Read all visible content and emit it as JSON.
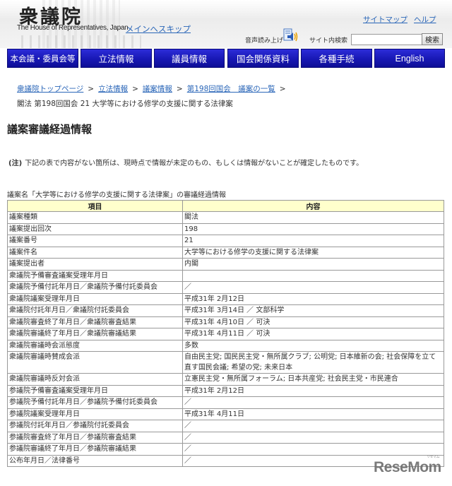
{
  "header": {
    "logo_kanji": "衆議院",
    "logo_english": "The House of Representatives, Japan",
    "skip_link": "メインへスキップ",
    "sitemap_link": "サイトマップ",
    "help_link": "ヘルプ",
    "tts_label": "音声読み上げ",
    "tts_icon": "speaker-icon",
    "search_label": "サイト内検索",
    "search_value": "",
    "search_button": "検索"
  },
  "nav": {
    "items": [
      {
        "label": "本会議・委員会等"
      },
      {
        "label": "立法情報"
      },
      {
        "label": "議員情報"
      },
      {
        "label": "国会関係資料"
      },
      {
        "label": "各種手続"
      },
      {
        "label": "English"
      }
    ],
    "color": "#1a1ab8"
  },
  "breadcrumb": {
    "items": [
      "衆議院トップページ",
      "立法情報",
      "議案情報",
      "第198回国会　議案の一覧"
    ],
    "separator": ">",
    "current": "閣法 第198回国会 21 大学等における修学の支援に関する法律案"
  },
  "page_title": "議案審議経過情報",
  "note": {
    "prefix": "(注)",
    "text": "下記の表で内容がない箇所は、現時点で情報が未定のもの、もしくは情報がないことが確定したものです。"
  },
  "table": {
    "caption": "議案名「大学等における修学の支援に関する法律案」の審議経過情報",
    "header_color": "#ffffcc",
    "columns": [
      "項目",
      "内容"
    ],
    "rows": [
      {
        "item": "議案種類",
        "value": "閣法"
      },
      {
        "item": "議案提出回次",
        "value": "198"
      },
      {
        "item": "議案番号",
        "value": "21"
      },
      {
        "item": "議案件名",
        "value": "大学等における修学の支援に関する法律案"
      },
      {
        "item": "議案提出者",
        "value": "内閣"
      },
      {
        "item": "衆議院予備審査議案受理年月日",
        "value": ""
      },
      {
        "item": "衆議院予備付託年月日／衆議院予備付託委員会",
        "value": "／"
      },
      {
        "item": "衆議院議案受理年月日",
        "value": "平成31年 2月12日"
      },
      {
        "item": "衆議院付託年月日／衆議院付託委員会",
        "value": "平成31年 3月14日 ／ 文部科学"
      },
      {
        "item": "衆議院審査終了年月日／衆議院審査結果",
        "value": "平成31年 4月10日 ／ 可決"
      },
      {
        "item": "衆議院審議終了年月日／衆議院審議結果",
        "value": "平成31年 4月11日 ／ 可決"
      },
      {
        "item": "衆議院審議時会派態度",
        "value": "多数"
      },
      {
        "item": "衆議院審議時賛成会派",
        "value": "自由民主党; 国民民主党・無所属クラブ; 公明党; 日本維新の会; 社会保障を立て直す国民会議; 希望の党; 未来日本"
      },
      {
        "item": "衆議院審議時反対会派",
        "value": "立憲民主党・無所属フォーラム; 日本共産党; 社会民主党・市民連合"
      },
      {
        "item": "参議院予備審査議案受理年月日",
        "value": "平成31年 2月12日"
      },
      {
        "item": "参議院予備付託年月日／参議院予備付託委員会",
        "value": "／"
      },
      {
        "item": "参議院議案受理年月日",
        "value": "平成31年 4月11日"
      },
      {
        "item": "参議院付託年月日／参議院付託委員会",
        "value": "／"
      },
      {
        "item": "参議院審査終了年月日／参議院審査結果",
        "value": "／"
      },
      {
        "item": "参議院審議終了年月日／参議院審議結果",
        "value": "／"
      },
      {
        "item": "公布年月日／法律番号",
        "value": "／"
      }
    ]
  },
  "watermark": {
    "text": "ReseMom",
    "sub": "リセマム"
  }
}
